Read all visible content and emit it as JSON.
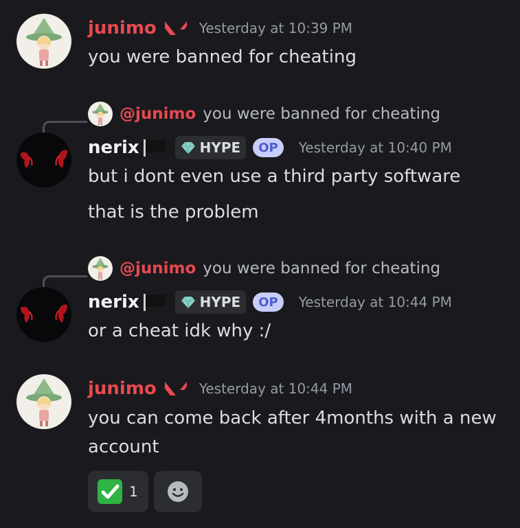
{
  "messages": [
    {
      "id": "m1",
      "username": "junimo",
      "timestamp": "Yesterday at 10:39 PM",
      "lines": [
        "you were banned for cheating"
      ],
      "badge_icon": "valorant-icon"
    },
    {
      "id": "m2",
      "username": "nerix",
      "timestamp": "Yesterday at 10:40 PM",
      "reply": {
        "mention": "@junimo",
        "snippet": "you were banned for cheating"
      },
      "tag": {
        "icon": "diamond-icon",
        "label": "HYPE"
      },
      "op_label": "OP",
      "lines": [
        "but i dont even use a third party software",
        "that is the problem"
      ]
    },
    {
      "id": "m3",
      "username": "nerix",
      "timestamp": "Yesterday at 10:44 PM",
      "reply": {
        "mention": "@junimo",
        "snippet": "you were banned for cheating"
      },
      "tag": {
        "icon": "diamond-icon",
        "label": "HYPE"
      },
      "op_label": "OP",
      "lines": [
        "or a cheat idk why :/"
      ]
    },
    {
      "id": "m4",
      "username": "junimo",
      "timestamp": "Yesterday at 10:44 PM",
      "lines": [
        "you can come back after 4months with a new",
        "account"
      ],
      "badge_icon": "valorant-icon",
      "reactions": [
        {
          "emoji": "check-mark-icon",
          "count": "1"
        }
      ]
    }
  ],
  "colors": {
    "background": "#1a1a1e",
    "username_red": "#e84a4f",
    "text": "#dbdee1",
    "muted": "#949ba4",
    "op_bg": "#c9cdfb",
    "op_text": "#4e5dcf",
    "check_green": "#2fb344"
  }
}
